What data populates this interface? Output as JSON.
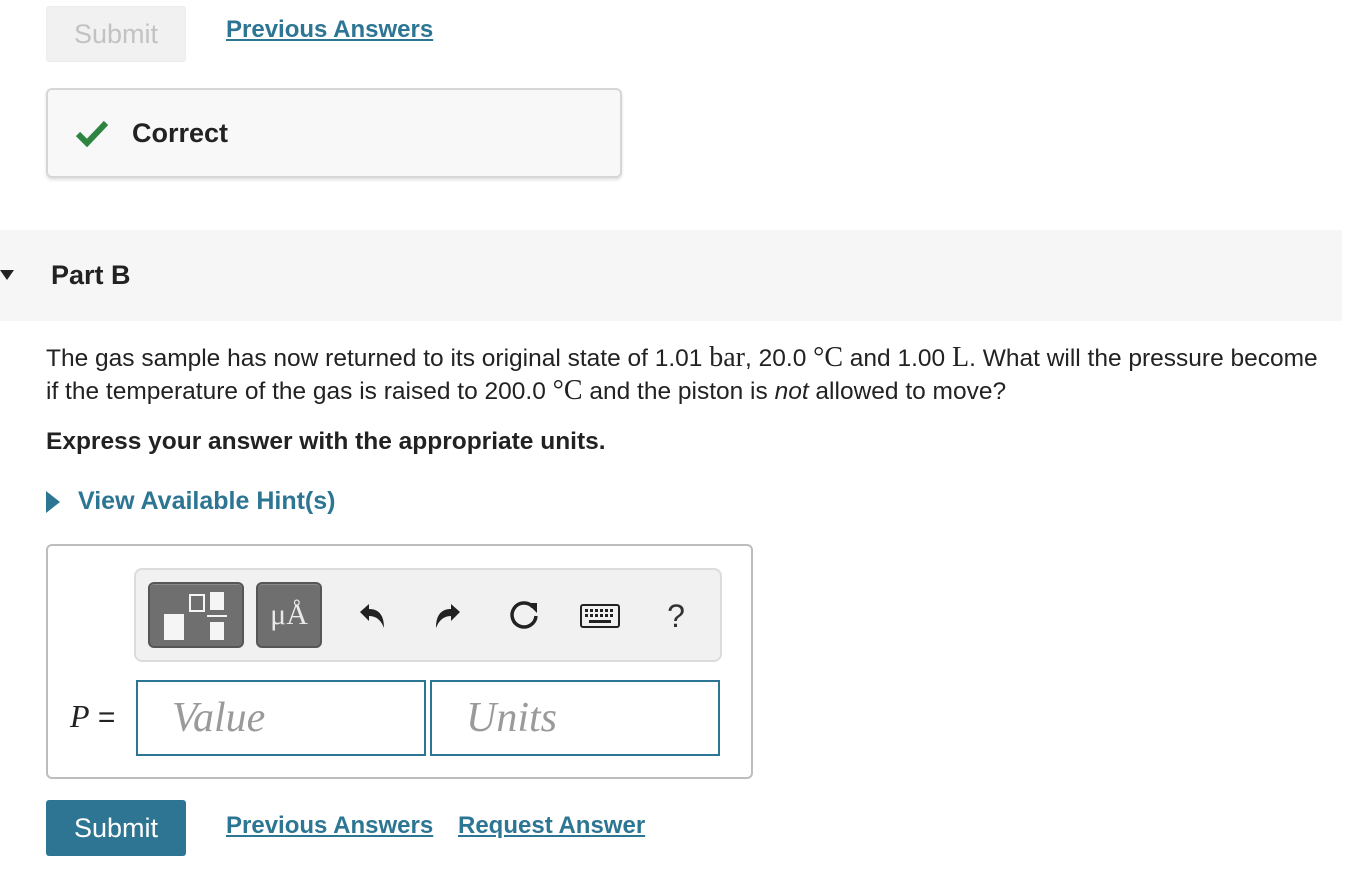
{
  "top_actions": {
    "submit_label": "Submit",
    "previous_answers_label": "Previous Answers"
  },
  "feedback": {
    "status": "Correct",
    "icon": "check-icon",
    "color": "#2e8540"
  },
  "part": {
    "title": "Part B",
    "question": {
      "text_1": "The gas sample has now returned to its original state of 1.01 ",
      "unit_bar": "bar",
      "text_2": ", 20.0 ",
      "unit_c_1": "°C",
      "text_3": " and 1.00 ",
      "unit_l": "L",
      "text_4": ". What will the pressure become if the temperature of the gas is raised to 200.0 ",
      "unit_c_2": "°C",
      "text_5": " and the piston is ",
      "emphasis": "not",
      "text_6": " allowed to move?"
    },
    "instruction": "Express your answer with the appropriate units.",
    "hint_label": "View Available Hint(s)"
  },
  "answer": {
    "toolbar": {
      "templates_icon": "templates-icon",
      "units_label": "μÅ",
      "undo_icon": "undo-icon",
      "redo_icon": "redo-icon",
      "reset_icon": "reset-icon",
      "keyboard_icon": "keyboard-icon",
      "help_label": "?"
    },
    "variable": "P",
    "equals": " =",
    "value_placeholder": "Value",
    "units_placeholder": "Units"
  },
  "bottom_actions": {
    "submit_label": "Submit",
    "previous_answers_label": "Previous Answers",
    "request_answer_label": "Request Answer"
  },
  "colors": {
    "link": "#2c7593",
    "submit_bg": "#2e7594",
    "input_border": "#2c7593"
  }
}
